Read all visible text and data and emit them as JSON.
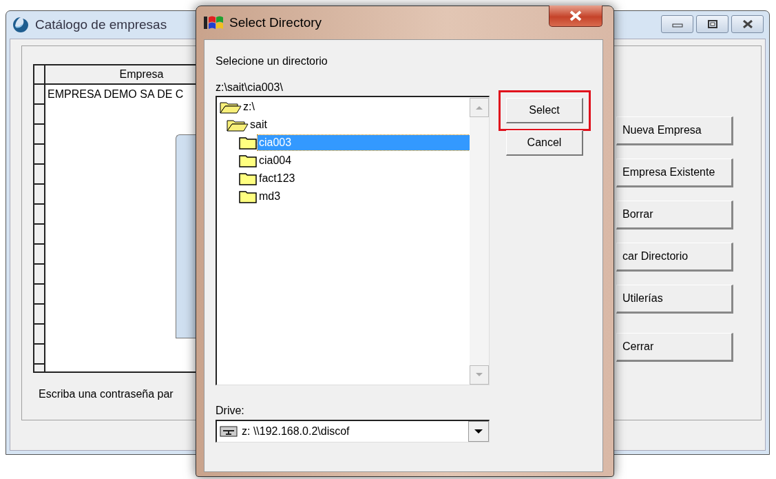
{
  "background_window": {
    "title": "Catálogo de empresas",
    "grid": {
      "columns": [
        "Empresa"
      ],
      "rows": [
        [
          "EMPRESA DEMO SA DE C"
        ]
      ]
    },
    "status_text": "Escriba una contraseña par",
    "buttons": [
      {
        "label": "Nueva Empresa"
      },
      {
        "label": "Empresa Existente"
      },
      {
        "label": "Borrar"
      },
      {
        "label": "car Directorio"
      },
      {
        "label": "Utilerías"
      },
      {
        "label": "Cerrar"
      }
    ]
  },
  "dialog": {
    "title": "Select Directory",
    "prompt": "Selecione un directorio",
    "current_path": "z:\\sait\\cia003\\",
    "tree": [
      {
        "label": "z:\\",
        "expanded": true,
        "selected": false,
        "children": [
          {
            "label": "sait",
            "expanded": true,
            "selected": false,
            "children": [
              {
                "label": "cia003",
                "expanded": false,
                "selected": true
              },
              {
                "label": "cia004",
                "expanded": false,
                "selected": false
              },
              {
                "label": "fact123",
                "expanded": false,
                "selected": false
              },
              {
                "label": "md3",
                "expanded": false,
                "selected": false
              }
            ]
          }
        ]
      }
    ],
    "buttons": [
      {
        "label": "Select",
        "highlighted": true
      },
      {
        "label": "Cancel",
        "highlighted": false
      }
    ],
    "drive_label": "Drive:",
    "drive": {
      "value": "z: \\\\192.168.0.2\\discof"
    }
  }
}
